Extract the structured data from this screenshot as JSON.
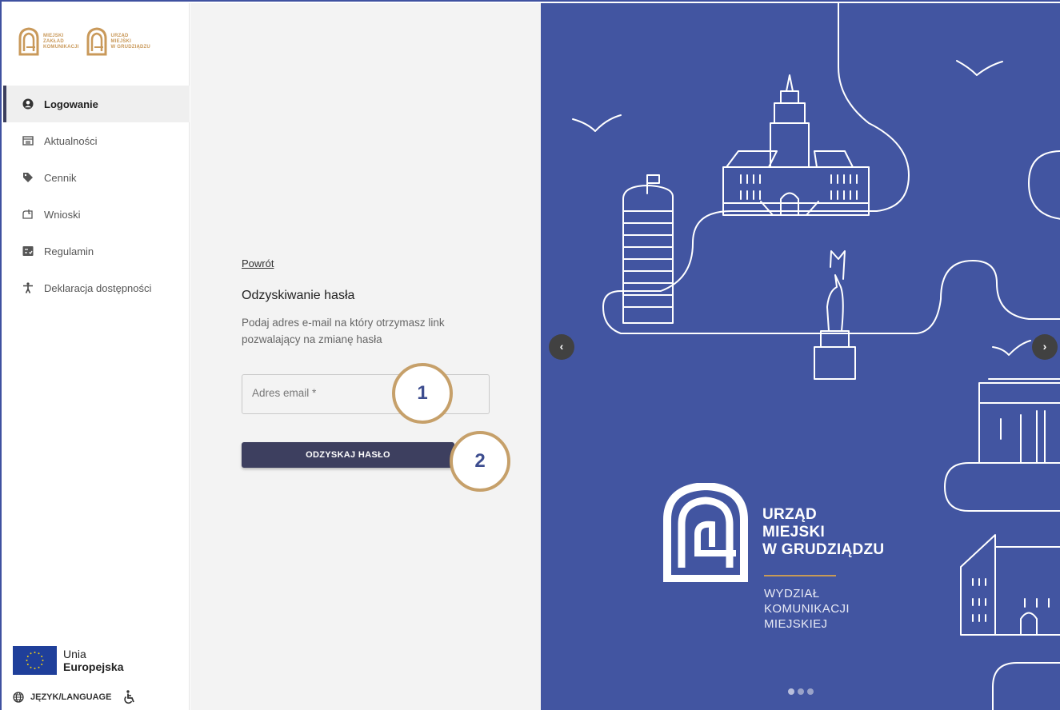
{
  "sidebar": {
    "brand_left": [
      "MIEJSKI",
      "ZAKŁAD",
      "KOMUNIKACJI"
    ],
    "brand_right": [
      "URZĄD",
      "MIEJSKI",
      "W GRUDZIĄDZU"
    ],
    "items": [
      {
        "label": "Logowanie",
        "icon": "user-circle-icon",
        "active": true
      },
      {
        "label": "Aktualności",
        "icon": "newspaper-icon"
      },
      {
        "label": "Cennik",
        "icon": "tag-icon"
      },
      {
        "label": "Wnioski",
        "icon": "mailbox-icon"
      },
      {
        "label": "Regulamin",
        "icon": "checklist-icon"
      },
      {
        "label": "Deklaracja dostępności",
        "icon": "accessibility-person-icon"
      }
    ],
    "eu_line1": "Unia",
    "eu_line2": "Europejska",
    "language_label": "JĘZYK/LANGUAGE"
  },
  "form": {
    "back_label": "Powrót",
    "title": "Odzyskiwanie hasła",
    "description": "Podaj adres e-mail na który otrzymasz link pozwalający na zmianę hasła",
    "email_placeholder": "Adres email *",
    "email_value": "",
    "submit_label": "ODZYSKAJ HASŁO"
  },
  "callouts": [
    "1",
    "2"
  ],
  "carousel": {
    "title_lines": [
      "URZĄD",
      "MIEJSKI",
      "W GRUDZIĄDZU"
    ],
    "subtitle_lines": [
      "WYDZIAŁ",
      "KOMUNIKACJI",
      "MIEJSKIEJ"
    ],
    "prev_icon": "chevron-left-icon",
    "next_icon": "chevron-right-icon",
    "slide_count": 3,
    "active_slide": 1
  },
  "colors": {
    "carousel_bg": "#4255a1",
    "button_bg": "#3d3f5f",
    "gold": "#c6a06a",
    "sidebar_active": "#efefef"
  }
}
